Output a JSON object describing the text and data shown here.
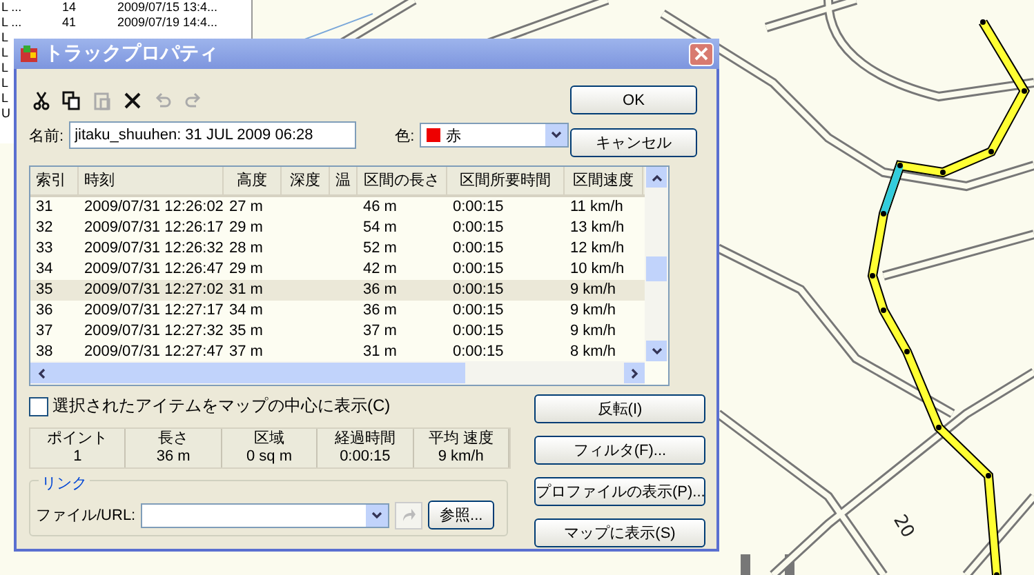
{
  "background_list": {
    "rows": [
      [
        "L ...",
        "14",
        "2009/07/15 13:4..."
      ],
      [
        "L ...",
        "41",
        "2009/07/19 14:4..."
      ],
      [
        "L"
      ],
      [
        "L"
      ],
      [
        "L"
      ],
      [
        "L"
      ],
      [
        "L"
      ],
      [
        "U"
      ]
    ]
  },
  "map": {
    "label": "20"
  },
  "dialog": {
    "title": "トラックプロパティ",
    "toolbar": [
      {
        "kind": "cut",
        "disabled": false
      },
      {
        "kind": "copy",
        "disabled": false
      },
      {
        "kind": "paste",
        "disabled": true
      },
      {
        "kind": "delete",
        "disabled": false
      },
      {
        "kind": "undo",
        "disabled": true
      },
      {
        "kind": "redo",
        "disabled": true
      }
    ],
    "name_label": "名前:",
    "name_value": "jitaku_shuuhen: 31 JUL 2009 06:28",
    "color_label": "色:",
    "color_value": "赤",
    "ok_button": "OK",
    "cancel_button": "キャンセル",
    "table": {
      "columns": [
        "索引",
        "時刻",
        "高度",
        "深度",
        "温",
        "区間の長さ",
        "区間所要時間",
        "区間速度"
      ],
      "rows": [
        {
          "cells": [
            "31",
            "2009/07/31 12:26:02",
            "27 m",
            "",
            "",
            "46 m",
            "0:00:15",
            "11 km/h"
          ],
          "selected": false
        },
        {
          "cells": [
            "32",
            "2009/07/31 12:26:17",
            "29 m",
            "",
            "",
            "54 m",
            "0:00:15",
            "13 km/h"
          ],
          "selected": false
        },
        {
          "cells": [
            "33",
            "2009/07/31 12:26:32",
            "28 m",
            "",
            "",
            "52 m",
            "0:00:15",
            "12 km/h"
          ],
          "selected": false
        },
        {
          "cells": [
            "34",
            "2009/07/31 12:26:47",
            "29 m",
            "",
            "",
            "42 m",
            "0:00:15",
            "10 km/h"
          ],
          "selected": false
        },
        {
          "cells": [
            "35",
            "2009/07/31 12:27:02",
            "31 m",
            "",
            "",
            "36 m",
            "0:00:15",
            "9 km/h"
          ],
          "selected": true
        },
        {
          "cells": [
            "36",
            "2009/07/31 12:27:17",
            "34 m",
            "",
            "",
            "36 m",
            "0:00:15",
            "9 km/h"
          ],
          "selected": false
        },
        {
          "cells": [
            "37",
            "2009/07/31 12:27:32",
            "35 m",
            "",
            "",
            "37 m",
            "0:00:15",
            "9 km/h"
          ],
          "selected": false
        },
        {
          "cells": [
            "38",
            "2009/07/31 12:27:47",
            "37 m",
            "",
            "",
            "31 m",
            "0:00:15",
            "8 km/h"
          ],
          "selected": false
        }
      ]
    },
    "center_checkbox": {
      "label": "選択されたアイテムをマップの中心に表示(C)",
      "checked": false
    },
    "stats": [
      {
        "label": "ポイント",
        "value": "1"
      },
      {
        "label": "長さ",
        "value": "36 m"
      },
      {
        "label": "区域",
        "value": "0 sq m"
      },
      {
        "label": "経過時間",
        "value": "0:00:15"
      },
      {
        "label": "平均 速度",
        "value": "9 km/h"
      }
    ],
    "link": {
      "legend": "リンク",
      "label": "ファイル/URL:",
      "browse_button": "参照..."
    },
    "actions": [
      "反転(I)",
      "フィルタ(F)...",
      "プロファイルの表示(P)...",
      "マップに表示(S)"
    ]
  }
}
